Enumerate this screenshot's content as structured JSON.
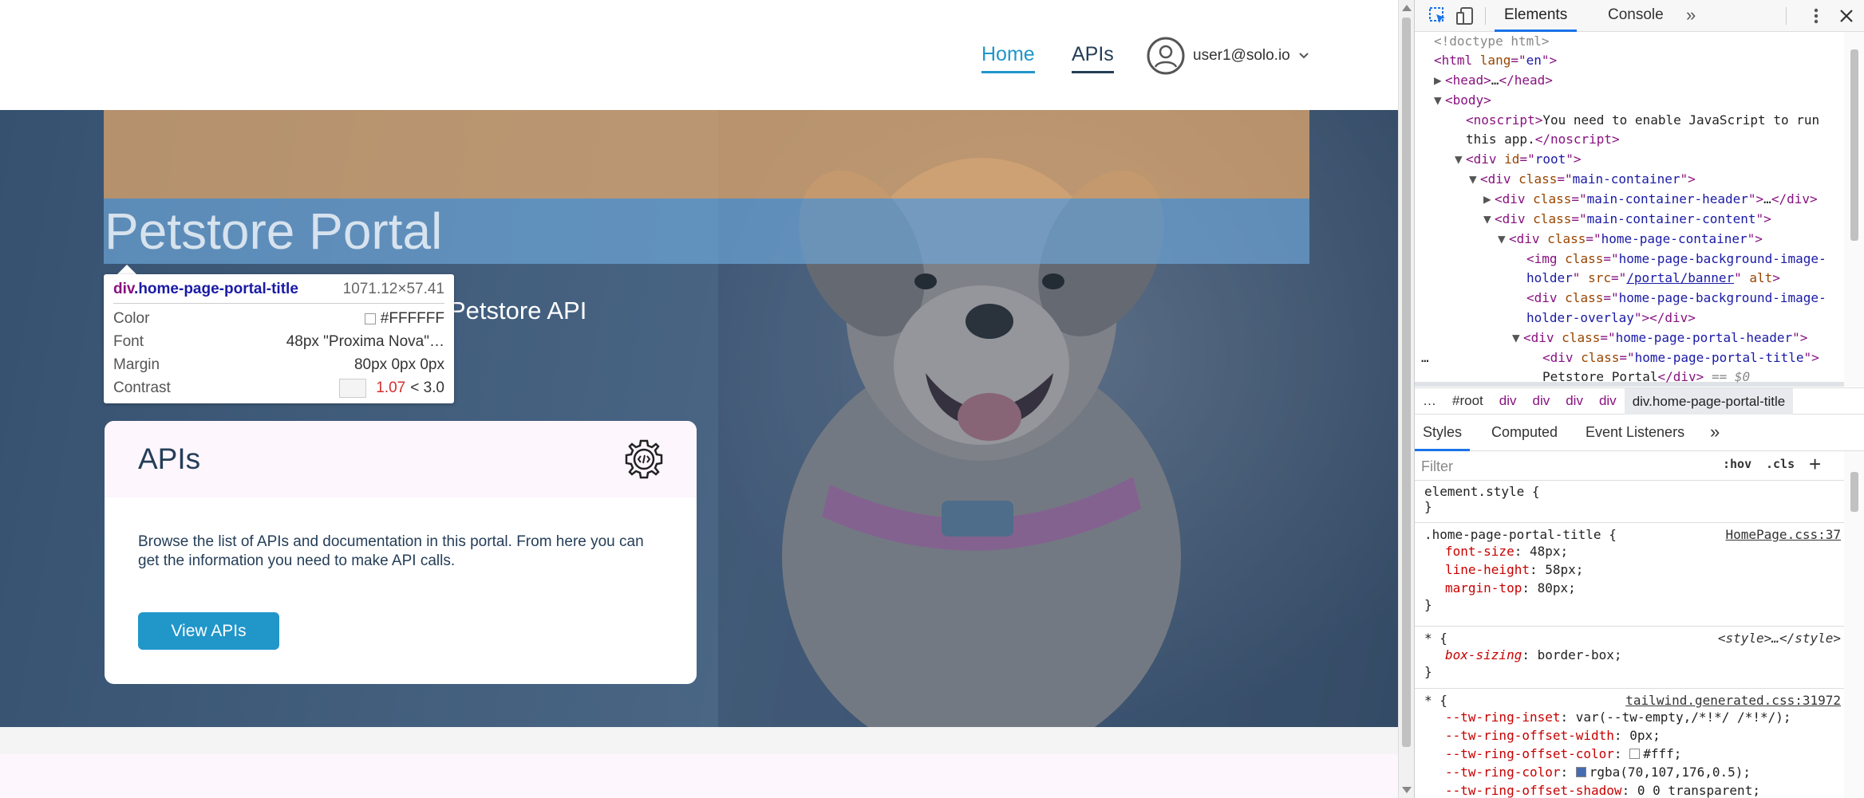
{
  "header": {
    "nav": [
      {
        "label": "Home",
        "active": true
      },
      {
        "label": "APIs",
        "active": false
      }
    ],
    "user": {
      "name": "user1@solo.io",
      "icon": "chevron-down-icon"
    }
  },
  "hero": {
    "portal_title": "Petstore Portal",
    "portal_subtitle": "Petstore API"
  },
  "tooltip": {
    "element_tag": "div",
    "element_class": ".home-page-portal-title",
    "size": "1071.12×57.41",
    "rows": [
      {
        "label": "Color",
        "value": "#FFFFFF"
      },
      {
        "label": "Font",
        "value": "48px \"Proxima Nova\"…"
      },
      {
        "label": "Margin",
        "value": "80px 0px 0px"
      }
    ],
    "contrast_label": "Contrast",
    "contrast_value": "1.07",
    "contrast_threshold": "< 3.0"
  },
  "api_card": {
    "title": "APIs",
    "description": "Browse the list of APIs and documentation in this portal. From here you can get the information you need to make API calls.",
    "button_label": "View APIs"
  },
  "devtools": {
    "tabs": [
      "Elements",
      "Console"
    ],
    "active_tab": "Elements",
    "dom": {
      "doctype": "<!doctype html>",
      "html_lang": "en",
      "noscript_text": "You need to enable JavaScript to run",
      "noscript_text2": "this app.",
      "root_id": "root",
      "classes": {
        "main_container": "main-container",
        "main_container_header": "main-container-header",
        "main_container_content": "main-container-content",
        "home_page_container": "home-page-container",
        "bg_holder": "home-page-background-image-",
        "bg_holder2": "holder",
        "bg_src": "/portal/banner",
        "overlay": "home-page-background-image-",
        "overlay2": "holder-overlay",
        "portal_header": "home-page-portal-header",
        "portal_title": "home-page-portal-title"
      },
      "selected_text": "Petstore Portal",
      "selected_marker": "== $0"
    },
    "breadcrumb": [
      "…",
      "#root",
      "div",
      "div",
      "div",
      "div",
      "div.home-page-portal-title"
    ],
    "style_tabs": [
      "Styles",
      "Computed",
      "Event Listeners"
    ],
    "active_style_tab": "Styles",
    "filter_placeholder": "Filter",
    "filter_buttons": [
      ":hov",
      ".cls",
      "+"
    ],
    "rules": [
      {
        "selector": "element.style {",
        "source": "",
        "props": []
      },
      {
        "selector": ".home-page-portal-title {",
        "source": "HomePage.css:37",
        "props": [
          [
            "font-size",
            "48px;"
          ],
          [
            "line-height",
            "58px;"
          ],
          [
            "margin-top",
            "80px;"
          ]
        ]
      },
      {
        "selector": "* {",
        "source": "<style>…</style>",
        "props": [
          [
            "box-sizing",
            "border-box;"
          ]
        ]
      },
      {
        "selector": "* {",
        "source": "tailwind.generated.css:31972",
        "props": [
          [
            "--tw-ring-inset",
            "var(--tw-empty,/*!*/ /*!*/);"
          ],
          [
            "--tw-ring-offset-width",
            "0px;"
          ],
          [
            "--tw-ring-offset-color",
            "#fff;"
          ],
          [
            "--tw-ring-color",
            "rgba(70,107,176,0.5);"
          ],
          [
            "--tw-ring-offset-shadow",
            "0 0 transparent;"
          ]
        ]
      }
    ],
    "colors": {
      "ring": "#466bb0",
      "offset": "#ffffff"
    }
  },
  "colors": {
    "accent": "#2196c9",
    "nav_text": "#253e58",
    "card_header_bg": "#fdf6fd",
    "margin_highlight": "#f6b26b",
    "content_highlight": "#6fa8dc"
  }
}
